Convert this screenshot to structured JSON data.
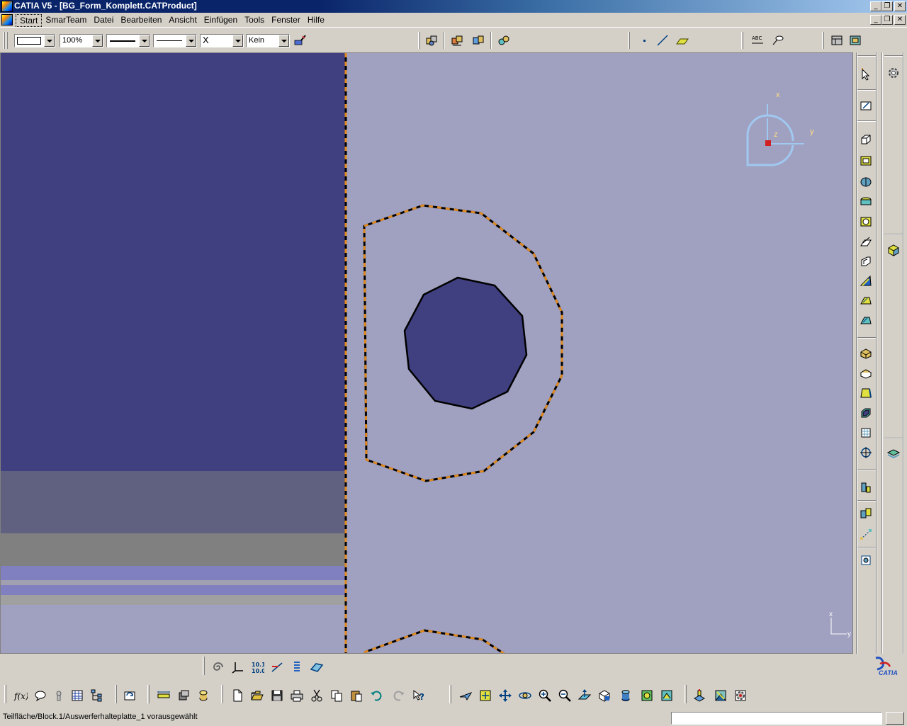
{
  "window": {
    "title": "CATIA V5 - [BG_Form_Komplett.CATProduct]"
  },
  "menu": {
    "items": [
      "Start",
      "SmarTeam",
      "Datei",
      "Bearbeiten",
      "Ansicht",
      "Einfügen",
      "Tools",
      "Fenster",
      "Hilfe"
    ],
    "active": "Start"
  },
  "toolbar_top": {
    "zoom_value": "100%",
    "layer_value": "Kein",
    "point_style": "X"
  },
  "compass": {
    "x_label": "x",
    "y_label": "y",
    "z_label": "z"
  },
  "axis_indicator": {
    "x_label": "x",
    "y_label": "y"
  },
  "status": {
    "message": "Teilfläche/Block.1/Auswerferhalteplatte_1 vorausgewählt",
    "command_value": ""
  },
  "colors": {
    "viewport_bg": "#a0a0c0",
    "part_dark": "#404080",
    "highlight_orange": "#e08a20"
  },
  "icons": {
    "top_toolbar": [
      "fill-color-icon",
      "assembly-icon",
      "assembly-constraint-icon",
      "assembly-move-icon",
      "product-icon",
      "point-icon",
      "line-icon",
      "plane-icon",
      "text-icon",
      "annotation-icon",
      "layout-icon",
      "view-icon"
    ],
    "right_toolbar": [
      "select-icon",
      "sketch-icon",
      "pad-icon",
      "pocket-icon",
      "shaft-icon",
      "groove-icon",
      "hole-icon",
      "rib-icon",
      "slot-icon",
      "stiffener-icon",
      "loft-icon",
      "remove-loft-icon",
      "fillet-icon",
      "chamfer-icon",
      "draft-icon",
      "shell-icon",
      "thickness-icon",
      "thread-icon",
      "split-icon",
      "boolean-icon",
      "transform-icon",
      "measure-icon",
      "gear-icon",
      "solid-icon",
      "surface-icon"
    ],
    "bottom_toolbar": [
      "formula-icon",
      "comment-icon",
      "knowledge-icon",
      "table-icon",
      "tree-icon",
      "update-icon",
      "measure-between-icon",
      "measure-item-icon",
      "inertia-icon",
      "new-icon",
      "open-icon",
      "save-icon",
      "print-icon",
      "cut-icon",
      "copy-icon",
      "paste-icon",
      "undo-icon",
      "redo-icon",
      "help-icon",
      "fly-icon",
      "fit-all-icon",
      "pan-icon",
      "rotate-icon",
      "zoom-in-icon",
      "zoom-out-icon",
      "normal-view-icon",
      "views-icon",
      "render-style-icon",
      "hide-show-icon",
      "swap-visible-icon",
      "catalog-icon",
      "analysis-icon",
      "options-icon"
    ],
    "tools_palette": [
      "spiral-icon",
      "axis-system-icon",
      "dimension-icon",
      "constraint-icon",
      "grid-icon",
      "plane-3d-icon"
    ]
  },
  "logo": {
    "text": "CATIA"
  }
}
